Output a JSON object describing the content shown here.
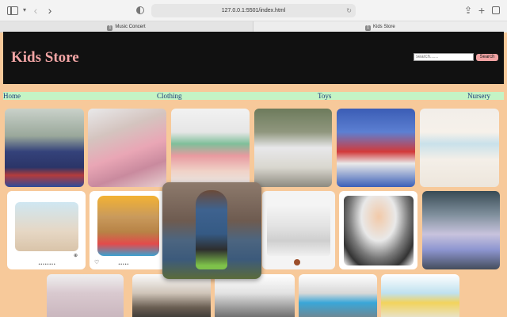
{
  "browser": {
    "url": "127.0.0.1:5501/index.html",
    "tabs": [
      {
        "label": "Music Concert",
        "active": false
      },
      {
        "label": "Kids Store",
        "active": true
      }
    ],
    "favicon_glyph": "1"
  },
  "store": {
    "title": "Kids Store",
    "search_placeholder": "search......",
    "search_button": "Search"
  },
  "nav": [
    "Home",
    "Clothing",
    "Toys",
    "Nursery"
  ],
  "products": {
    "row1": [
      "boy-in-hoodie-with-captain-america-shield",
      "girl-in-fur-jacket-with-sunglasses",
      "girl-in-floral-dress",
      "boy-in-white-outfit",
      "boy-in-spiderman-shirt",
      "girl-white-dress-with-butterflies"
    ],
    "row2": [
      "baby-soother-toy-box",
      "plush-puppy-toy",
      "swing-and-slide-set",
      "baby-walker",
      "baby-in-walker"
    ],
    "row3": [
      "pink-play-kitchen",
      "stroller",
      "bassinet",
      "high-chair",
      "crib-mobile"
    ],
    "popup": "boy-with-skateboard-zoomed"
  },
  "colors": {
    "page_bg": "#f7c99a",
    "header_bg": "#111111",
    "title": "#f3a5a5",
    "nav_bg": "#c4f4c5",
    "nav_text": "#1a3a7a",
    "search_button": "#f1a3a3"
  }
}
